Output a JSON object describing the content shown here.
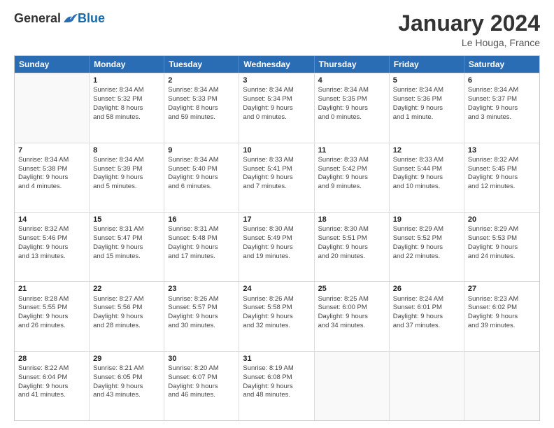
{
  "header": {
    "logo": {
      "general": "General",
      "blue": "Blue"
    },
    "title": "January 2024",
    "location": "Le Houga, France"
  },
  "calendar": {
    "days": [
      "Sunday",
      "Monday",
      "Tuesday",
      "Wednesday",
      "Thursday",
      "Friday",
      "Saturday"
    ],
    "rows": [
      [
        {
          "day": "",
          "lines": []
        },
        {
          "day": "1",
          "lines": [
            "Sunrise: 8:34 AM",
            "Sunset: 5:32 PM",
            "Daylight: 8 hours",
            "and 58 minutes."
          ]
        },
        {
          "day": "2",
          "lines": [
            "Sunrise: 8:34 AM",
            "Sunset: 5:33 PM",
            "Daylight: 8 hours",
            "and 59 minutes."
          ]
        },
        {
          "day": "3",
          "lines": [
            "Sunrise: 8:34 AM",
            "Sunset: 5:34 PM",
            "Daylight: 9 hours",
            "and 0 minutes."
          ]
        },
        {
          "day": "4",
          "lines": [
            "Sunrise: 8:34 AM",
            "Sunset: 5:35 PM",
            "Daylight: 9 hours",
            "and 0 minutes."
          ]
        },
        {
          "day": "5",
          "lines": [
            "Sunrise: 8:34 AM",
            "Sunset: 5:36 PM",
            "Daylight: 9 hours",
            "and 1 minute."
          ]
        },
        {
          "day": "6",
          "lines": [
            "Sunrise: 8:34 AM",
            "Sunset: 5:37 PM",
            "Daylight: 9 hours",
            "and 3 minutes."
          ]
        }
      ],
      [
        {
          "day": "7",
          "lines": [
            "Sunrise: 8:34 AM",
            "Sunset: 5:38 PM",
            "Daylight: 9 hours",
            "and 4 minutes."
          ]
        },
        {
          "day": "8",
          "lines": [
            "Sunrise: 8:34 AM",
            "Sunset: 5:39 PM",
            "Daylight: 9 hours",
            "and 5 minutes."
          ]
        },
        {
          "day": "9",
          "lines": [
            "Sunrise: 8:34 AM",
            "Sunset: 5:40 PM",
            "Daylight: 9 hours",
            "and 6 minutes."
          ]
        },
        {
          "day": "10",
          "lines": [
            "Sunrise: 8:33 AM",
            "Sunset: 5:41 PM",
            "Daylight: 9 hours",
            "and 7 minutes."
          ]
        },
        {
          "day": "11",
          "lines": [
            "Sunrise: 8:33 AM",
            "Sunset: 5:42 PM",
            "Daylight: 9 hours",
            "and 9 minutes."
          ]
        },
        {
          "day": "12",
          "lines": [
            "Sunrise: 8:33 AM",
            "Sunset: 5:44 PM",
            "Daylight: 9 hours",
            "and 10 minutes."
          ]
        },
        {
          "day": "13",
          "lines": [
            "Sunrise: 8:32 AM",
            "Sunset: 5:45 PM",
            "Daylight: 9 hours",
            "and 12 minutes."
          ]
        }
      ],
      [
        {
          "day": "14",
          "lines": [
            "Sunrise: 8:32 AM",
            "Sunset: 5:46 PM",
            "Daylight: 9 hours",
            "and 13 minutes."
          ]
        },
        {
          "day": "15",
          "lines": [
            "Sunrise: 8:31 AM",
            "Sunset: 5:47 PM",
            "Daylight: 9 hours",
            "and 15 minutes."
          ]
        },
        {
          "day": "16",
          "lines": [
            "Sunrise: 8:31 AM",
            "Sunset: 5:48 PM",
            "Daylight: 9 hours",
            "and 17 minutes."
          ]
        },
        {
          "day": "17",
          "lines": [
            "Sunrise: 8:30 AM",
            "Sunset: 5:49 PM",
            "Daylight: 9 hours",
            "and 19 minutes."
          ]
        },
        {
          "day": "18",
          "lines": [
            "Sunrise: 8:30 AM",
            "Sunset: 5:51 PM",
            "Daylight: 9 hours",
            "and 20 minutes."
          ]
        },
        {
          "day": "19",
          "lines": [
            "Sunrise: 8:29 AM",
            "Sunset: 5:52 PM",
            "Daylight: 9 hours",
            "and 22 minutes."
          ]
        },
        {
          "day": "20",
          "lines": [
            "Sunrise: 8:29 AM",
            "Sunset: 5:53 PM",
            "Daylight: 9 hours",
            "and 24 minutes."
          ]
        }
      ],
      [
        {
          "day": "21",
          "lines": [
            "Sunrise: 8:28 AM",
            "Sunset: 5:55 PM",
            "Daylight: 9 hours",
            "and 26 minutes."
          ]
        },
        {
          "day": "22",
          "lines": [
            "Sunrise: 8:27 AM",
            "Sunset: 5:56 PM",
            "Daylight: 9 hours",
            "and 28 minutes."
          ]
        },
        {
          "day": "23",
          "lines": [
            "Sunrise: 8:26 AM",
            "Sunset: 5:57 PM",
            "Daylight: 9 hours",
            "and 30 minutes."
          ]
        },
        {
          "day": "24",
          "lines": [
            "Sunrise: 8:26 AM",
            "Sunset: 5:58 PM",
            "Daylight: 9 hours",
            "and 32 minutes."
          ]
        },
        {
          "day": "25",
          "lines": [
            "Sunrise: 8:25 AM",
            "Sunset: 6:00 PM",
            "Daylight: 9 hours",
            "and 34 minutes."
          ]
        },
        {
          "day": "26",
          "lines": [
            "Sunrise: 8:24 AM",
            "Sunset: 6:01 PM",
            "Daylight: 9 hours",
            "and 37 minutes."
          ]
        },
        {
          "day": "27",
          "lines": [
            "Sunrise: 8:23 AM",
            "Sunset: 6:02 PM",
            "Daylight: 9 hours",
            "and 39 minutes."
          ]
        }
      ],
      [
        {
          "day": "28",
          "lines": [
            "Sunrise: 8:22 AM",
            "Sunset: 6:04 PM",
            "Daylight: 9 hours",
            "and 41 minutes."
          ]
        },
        {
          "day": "29",
          "lines": [
            "Sunrise: 8:21 AM",
            "Sunset: 6:05 PM",
            "Daylight: 9 hours",
            "and 43 minutes."
          ]
        },
        {
          "day": "30",
          "lines": [
            "Sunrise: 8:20 AM",
            "Sunset: 6:07 PM",
            "Daylight: 9 hours",
            "and 46 minutes."
          ]
        },
        {
          "day": "31",
          "lines": [
            "Sunrise: 8:19 AM",
            "Sunset: 6:08 PM",
            "Daylight: 9 hours",
            "and 48 minutes."
          ]
        },
        {
          "day": "",
          "lines": []
        },
        {
          "day": "",
          "lines": []
        },
        {
          "day": "",
          "lines": []
        }
      ]
    ]
  }
}
